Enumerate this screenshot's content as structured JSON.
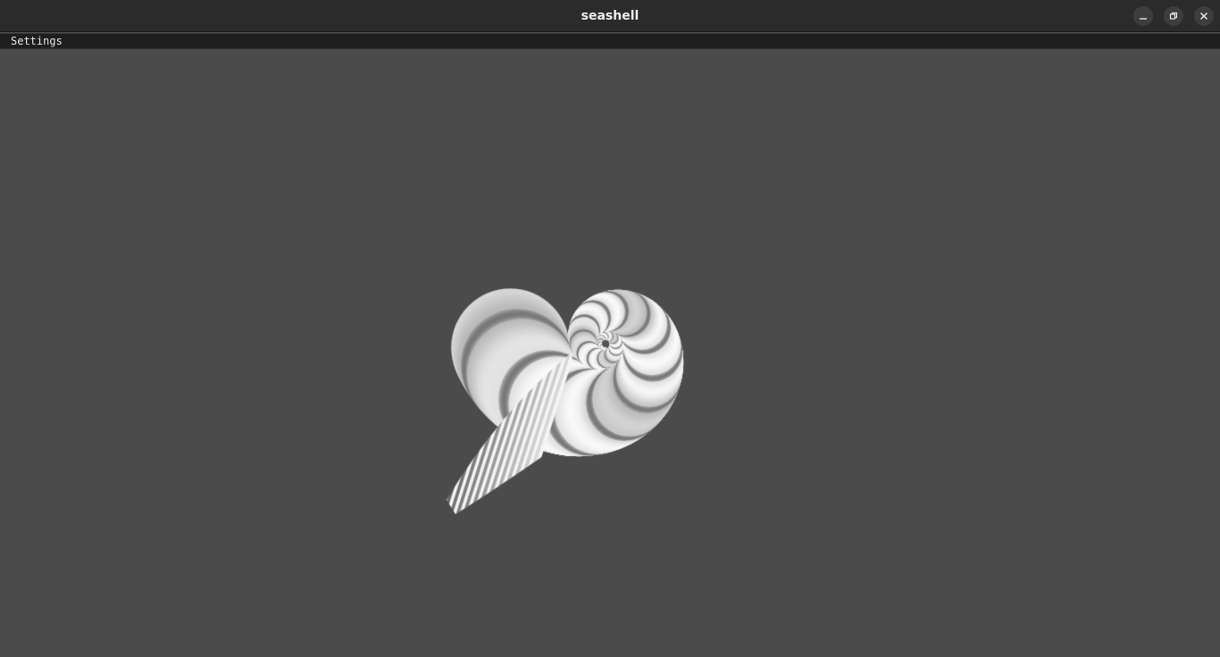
{
  "window": {
    "title": "seashell",
    "controls": {
      "minimize_icon": "minimize-icon",
      "maximize_icon": "restore-icon",
      "close_icon": "close-icon"
    }
  },
  "menubar": {
    "items": [
      {
        "label": "Settings"
      }
    ]
  },
  "viewport": {
    "background": "#4b4b4b",
    "object": "seashell",
    "shell_colors": {
      "light": "#f2f2f2",
      "dark": "#1a1a1a"
    }
  }
}
